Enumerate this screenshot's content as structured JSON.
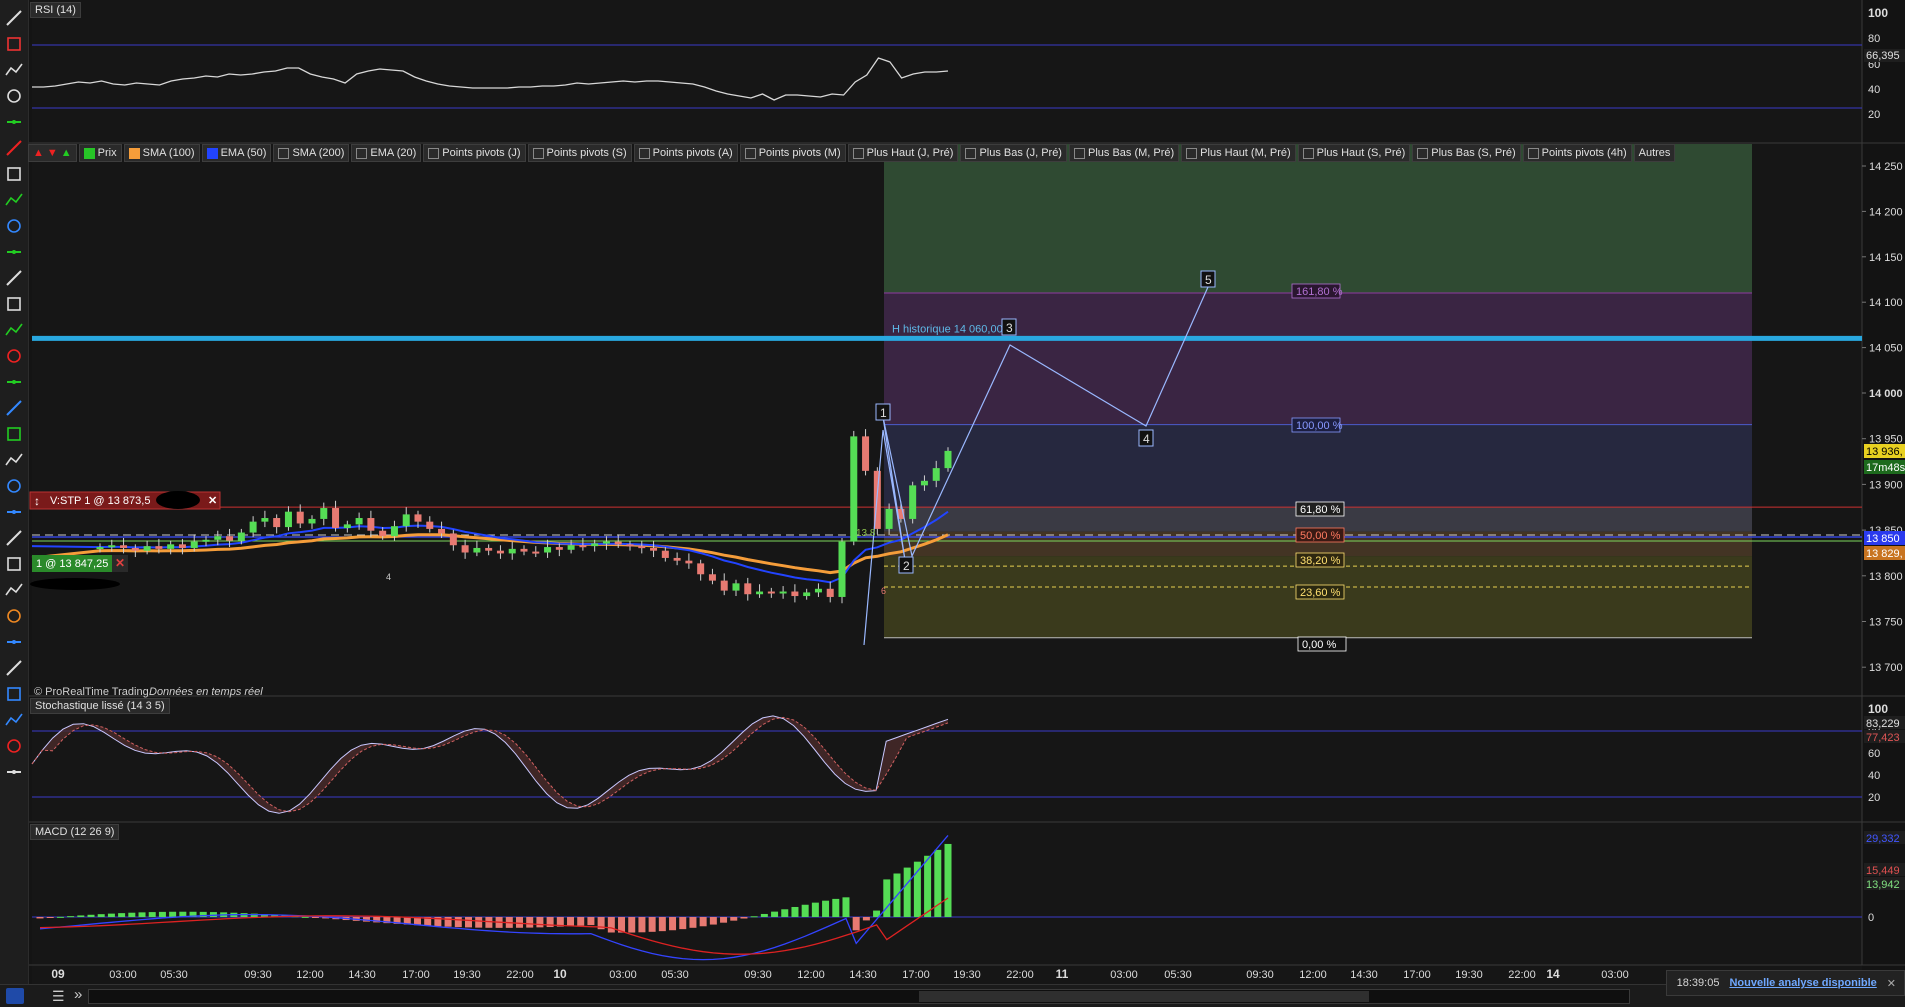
{
  "toolbar": {
    "icons": [
      "ruler-icon",
      "magnet-icon",
      "line-icon",
      "horizontal-line-icon",
      "trend-line-icon",
      "ray-icon",
      "trash-icon",
      "segment-icon",
      "rectangle-icon",
      "triangle-icon",
      "arrow-icon",
      "vertical-line-icon",
      "channel-icon",
      "fibonacci-icon",
      "zigzag-icon",
      "pitchfork-icon",
      "fan-icon",
      "cross-icon",
      "move-icon",
      "ellipse-icon",
      "copy-icon",
      "text-icon",
      "timer-icon",
      "circle-icon",
      "wave-icon",
      "pointer-icon",
      "elliott-icon",
      "diamond-icon",
      "eraser-icon",
      "settings-icon"
    ]
  },
  "panels": {
    "rsi": {
      "label": "RSI (14)",
      "ticks": [
        "100",
        "80",
        "60",
        "40",
        "20"
      ],
      "value": "66,395"
    },
    "stoch": {
      "label": "Stochastique lissé (14 3 5)",
      "ticks": [
        "100",
        "80",
        "60",
        "40",
        "20"
      ],
      "value1": "83,229",
      "value2": "77,423"
    },
    "macd": {
      "label": "MACD (12 26 9)",
      "ticks": [
        "0"
      ],
      "value1": "29,332",
      "value2": "15,449",
      "value3": "13,942"
    }
  },
  "legend": [
    {
      "label": "Prix",
      "color": "#27c427"
    },
    {
      "label": "SMA (100)",
      "color": "#f59d3a"
    },
    {
      "label": "EMA (50)",
      "color": "#2244ff"
    },
    {
      "label": "SMA (200)",
      "color": ""
    },
    {
      "label": "EMA (20)",
      "color": ""
    },
    {
      "label": "Points pivots (J)",
      "color": ""
    },
    {
      "label": "Points pivots (S)",
      "color": ""
    },
    {
      "label": "Points pivots (A)",
      "color": ""
    },
    {
      "label": "Points pivots (M)",
      "color": ""
    },
    {
      "label": "Plus Haut (J, Pré)",
      "color": ""
    },
    {
      "label": "Plus Bas (J, Pré)",
      "color": ""
    },
    {
      "label": "Plus Bas (M, Pré)",
      "color": ""
    },
    {
      "label": "Plus Haut (M, Pré)",
      "color": ""
    },
    {
      "label": "Plus Haut (S, Pré)",
      "color": ""
    },
    {
      "label": "Plus Bas (S, Pré)",
      "color": ""
    },
    {
      "label": "Points pivots (4h)",
      "color": ""
    },
    {
      "label": "Autres",
      "color": ""
    }
  ],
  "orders": {
    "stop_label": "V:STP 1 @ 13 873,5",
    "position_label": "1 @ 13 847,25"
  },
  "annotations": {
    "historic_high": "H historique 14 060,00",
    "copyright": "© ProRealTime Trading",
    "realtime": "Données en temps réel",
    "elliott_points": [
      "1",
      "2",
      "3",
      "4",
      "5"
    ],
    "fib_levels": [
      "161,80 %",
      "100,00 %",
      "61,80 %",
      "50,00 %",
      "38,20 %",
      "23,60 %",
      "0,00 %"
    ],
    "small_labels": [
      "13 8",
      "4",
      "6"
    ]
  },
  "price_axis": {
    "ticks": [
      "14 250",
      "14 200",
      "14 150",
      "14 100",
      "14 050",
      "14 000",
      "13 950",
      "13 900",
      "13 850",
      "13 800",
      "13 750",
      "13 700"
    ],
    "current_price": "13 936,",
    "countdown": "17m48s",
    "tag_blue": "13 850",
    "tag_orange": "13 829,"
  },
  "time_axis": {
    "labels": [
      "09",
      "03:00",
      "05:30",
      "09:30",
      "12:00",
      "14:30",
      "17:00",
      "19:30",
      "22:00",
      "10",
      "03:00",
      "05:30",
      "09:30",
      "12:00",
      "14:30",
      "17:00",
      "19:30",
      "22:00",
      "11",
      "03:00",
      "05:30",
      "09:30",
      "12:00",
      "14:30",
      "17:00",
      "19:30",
      "22:00",
      "14",
      "03:00"
    ],
    "day_labels": [
      "09",
      "10",
      "11",
      "14"
    ]
  },
  "status": {
    "time": "18:39:05",
    "notification": "Nouvelle analyse disponible"
  },
  "colors": {
    "up_candle": "#55dd55",
    "down_candle": "#e87a72",
    "sma100": "#f59d3a",
    "ema50": "#2244ff",
    "historic_line": "#29a8e0",
    "fib_green": "#2f4a32",
    "fib_purple": "#3a2543",
    "fib_blue": "#26283f",
    "fib_orange": "#433424",
    "fib_olive": "#3a3a1c"
  },
  "chart_data": {
    "type": "candlestick",
    "y_range": [
      13680,
      14270
    ],
    "historic_high": 14060,
    "fib": {
      "0": 13730,
      "23.6": 13786,
      "38.2": 13820,
      "50": 13847,
      "61.8": 13874,
      "100": 13965,
      "161.8": 14110
    },
    "close_series": [
      13830,
      13832,
      13829,
      13826,
      13831,
      13828,
      13833,
      13829,
      13836,
      13838,
      13842,
      13837,
      13846,
      13858,
      13862,
      13852,
      13869,
      13856,
      13861,
      13873,
      13851,
      13855,
      13862,
      13848,
      13842,
      13853,
      13866,
      13858,
      13850,
      13845,
      13832,
      13824,
      13829,
      13826,
      13823,
      13828,
      13825,
      13824,
      13830,
      13827,
      13832,
      13831,
      13834,
      13836,
      13833,
      13831,
      13829,
      13826,
      13818,
      13815,
      13812,
      13800,
      13793,
      13782,
      13790,
      13778,
      13781,
      13779,
      13781,
      13776,
      13780,
      13784,
      13775,
      13836,
      13952,
      13914,
      13850,
      13872,
      13861,
      13898,
      13903,
      13917,
      13936
    ],
    "rsi": [
      47,
      47,
      48,
      50,
      52,
      51,
      53,
      50,
      49,
      51,
      50,
      49,
      53,
      55,
      56,
      58,
      57,
      60,
      59,
      60,
      62,
      63,
      66,
      66,
      60,
      57,
      55,
      51,
      60,
      63,
      65,
      64,
      63,
      57,
      53,
      50,
      48,
      47,
      46,
      46,
      46,
      46,
      47,
      47,
      48,
      48,
      49,
      51,
      50,
      51,
      52,
      53,
      52,
      53,
      53,
      52,
      51,
      50,
      47,
      43,
      40,
      38,
      36,
      40,
      34,
      39,
      39,
      38,
      37,
      40,
      39,
      52,
      59,
      76,
      72,
      56,
      60,
      62,
      62,
      63
    ]
  }
}
